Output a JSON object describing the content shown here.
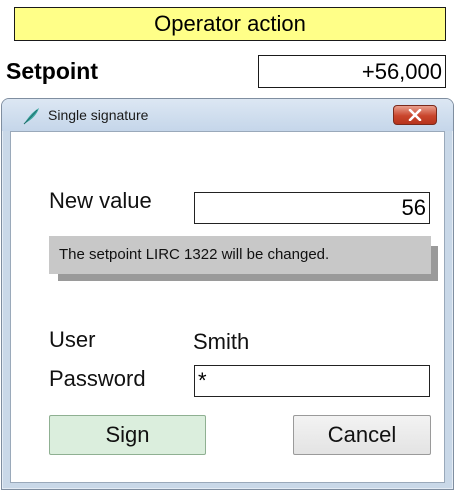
{
  "operator_action": {
    "label": "Operator action"
  },
  "setpoint": {
    "label": "Setpoint",
    "value": "+56,000"
  },
  "dialog": {
    "title": "Single signature",
    "new_value": {
      "label": "New value",
      "value": "56"
    },
    "message": "The setpoint LIRC 1322 will be changed.",
    "user": {
      "label": "User",
      "value": "Smith"
    },
    "password": {
      "label": "Password",
      "value": "*"
    },
    "buttons": {
      "sign": "Sign",
      "cancel": "Cancel"
    }
  },
  "colors": {
    "banner_background": "#ffff88",
    "dialog_frame": "#c9d8e8",
    "sign_button": "#dbeedd",
    "close_button": "#c9452c"
  },
  "icons": [
    "app-feather-icon",
    "close-icon"
  ]
}
